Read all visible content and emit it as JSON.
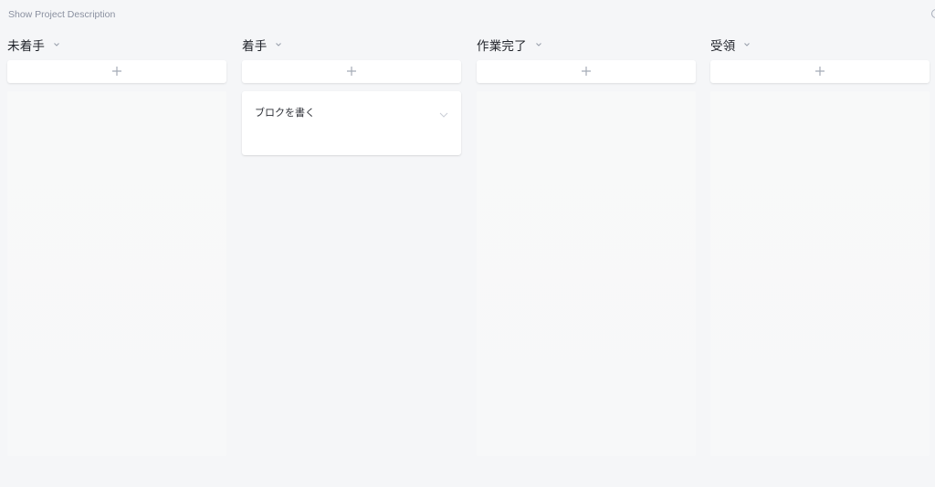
{
  "header": {
    "project_description_link": "Show Project Description"
  },
  "columns": [
    {
      "title": "未着手",
      "cards": []
    },
    {
      "title": "着手",
      "cards": [
        {
          "title": "ブロクを書く"
        }
      ]
    },
    {
      "title": "作業完了",
      "cards": []
    },
    {
      "title": "受領",
      "cards": []
    }
  ],
  "icons": {
    "column_menu": "chevron-down-icon",
    "add_card": "plus-icon",
    "card_menu": "chevron-down-icon",
    "edge": "circle-icon"
  },
  "colors": {
    "background": "#f5f6f8",
    "card": "#ffffff",
    "muted_text": "#8a90a0",
    "icon": "#a7adb9"
  }
}
